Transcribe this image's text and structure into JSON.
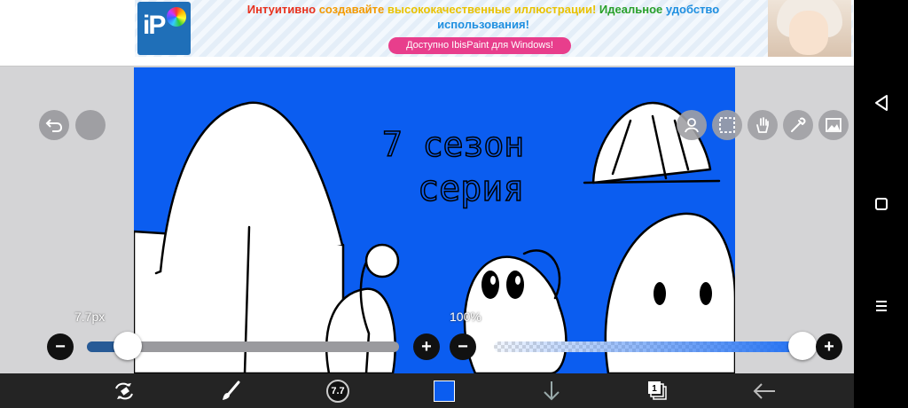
{
  "ad": {
    "headline_1": "Интуитивно",
    "headline_2": "создавайте",
    "headline_3": "высококачественные иллюстрации!",
    "headline_4": "Идеальное",
    "headline_5": "удобство",
    "headline_6": "использования!",
    "button_label": "Доступно IbisPaint для Windows!",
    "logo_letters": "iP"
  },
  "canvas": {
    "background_color": "#0b5df0",
    "text_line_1": "7 сезон",
    "text_line_2": "серия"
  },
  "brush_size": {
    "label": "7.7px",
    "value_fraction": 0.13
  },
  "opacity": {
    "label": "100%",
    "value_fraction": 1.0
  },
  "slider_buttons": {
    "minus": "−",
    "plus": "+"
  },
  "toolbar": {
    "brush_size_badge": "7.7",
    "layer_count": "1",
    "color": "#0b5df0"
  },
  "icons": {
    "undo": "undo-icon",
    "redo": "redo-icon",
    "transform": "transform-icon",
    "selection": "selection-icon",
    "hand": "hand-icon",
    "eyedropper": "eyedropper-icon",
    "image": "image-icon",
    "tool_switch": "tool-switch-icon",
    "brush": "brush-icon",
    "move_down": "arrow-down-icon",
    "layers": "layers-icon",
    "back": "back-arrow-icon"
  }
}
